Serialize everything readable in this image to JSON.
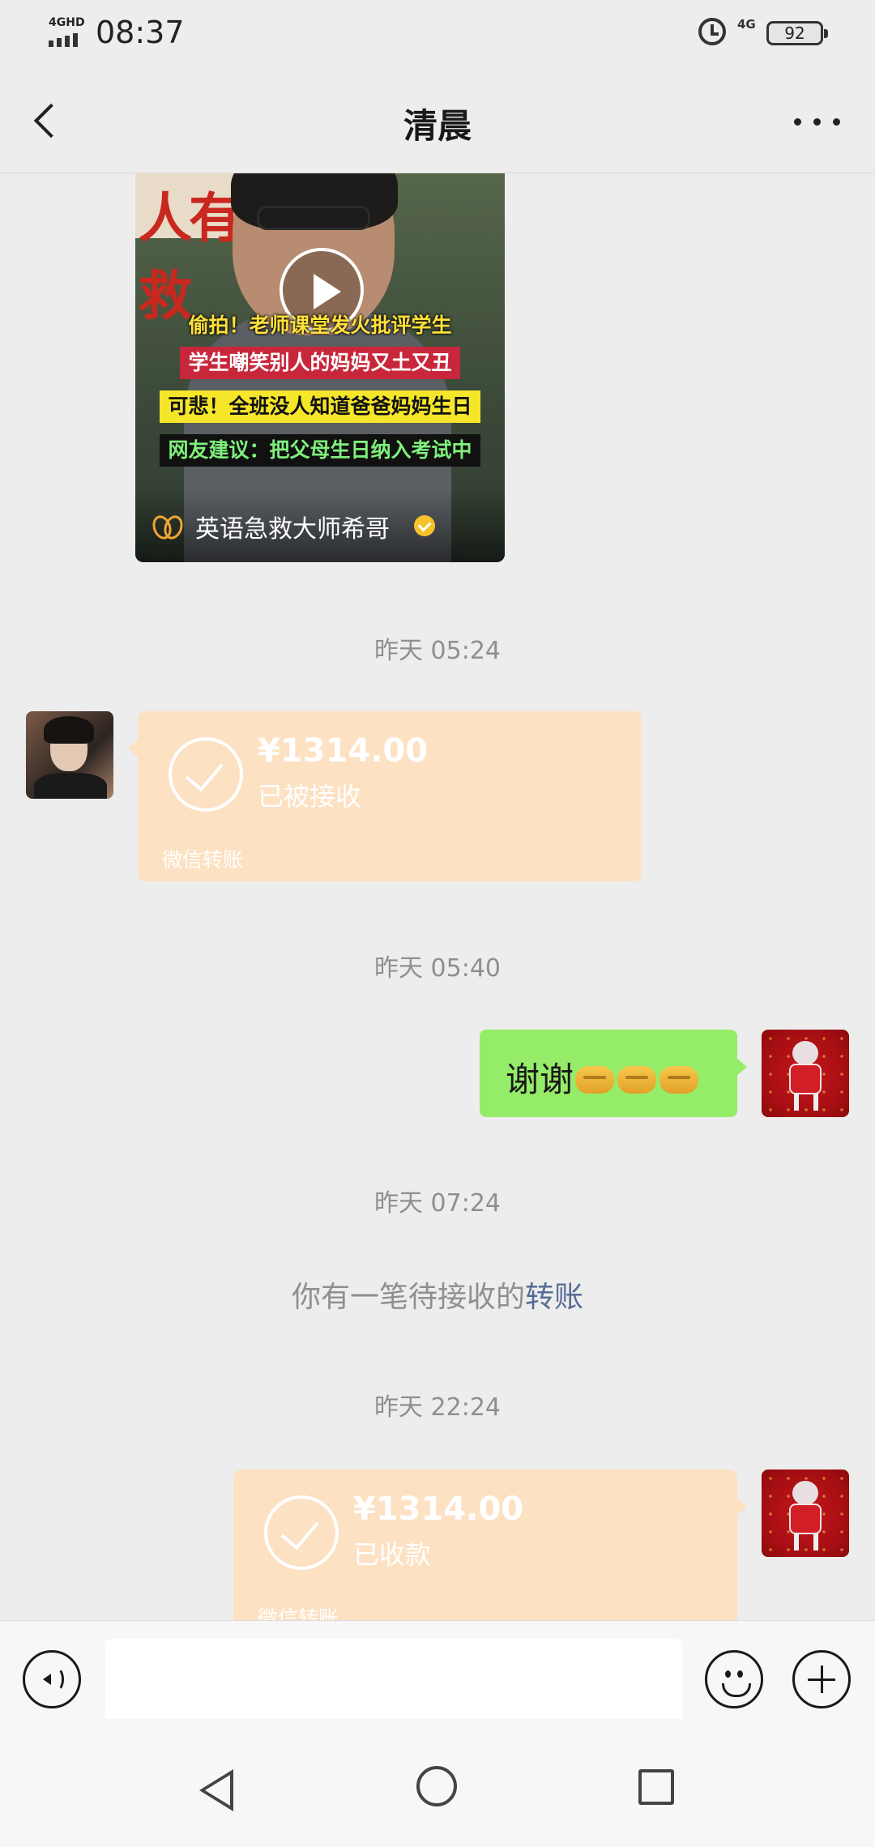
{
  "status_bar": {
    "network_label": "4GHD",
    "time": "08:37",
    "signal_label": "4G",
    "battery": "92"
  },
  "header": {
    "title": "清晨"
  },
  "video_card": {
    "captions": [
      "偷拍！老师课堂发火批评学生",
      "学生嘲笑别人的妈妈又土又丑",
      "可悲！全班没人知道爸爸妈妈生日",
      "网友建议：把父母生日纳入考试中"
    ],
    "author": "英语急救大师希哥"
  },
  "messages": [
    {
      "type": "timestamp",
      "text": "昨天 05:24"
    },
    {
      "type": "transfer",
      "side": "left",
      "amount": "¥1314.00",
      "status": "已被接收",
      "source": "微信转账"
    },
    {
      "type": "timestamp",
      "text": "昨天 05:40"
    },
    {
      "type": "text",
      "side": "right",
      "text": "谢谢"
    },
    {
      "type": "timestamp",
      "text": "昨天 07:24"
    },
    {
      "type": "system",
      "text": "你有一笔待接收的",
      "link": "转账"
    },
    {
      "type": "timestamp",
      "text": "昨天 22:24"
    },
    {
      "type": "transfer",
      "side": "right",
      "amount": "¥1314.00",
      "status": "已收款",
      "source": "微信转账"
    }
  ],
  "input_bar": {
    "placeholder": ""
  },
  "colors": {
    "transfer_bg": "#fde1c3",
    "my_bubble": "#95ec69",
    "link": "#576b95"
  },
  "icons": [
    "back-icon",
    "more-icon",
    "play-icon",
    "voice-icon",
    "emoji-icon",
    "plus-icon"
  ]
}
